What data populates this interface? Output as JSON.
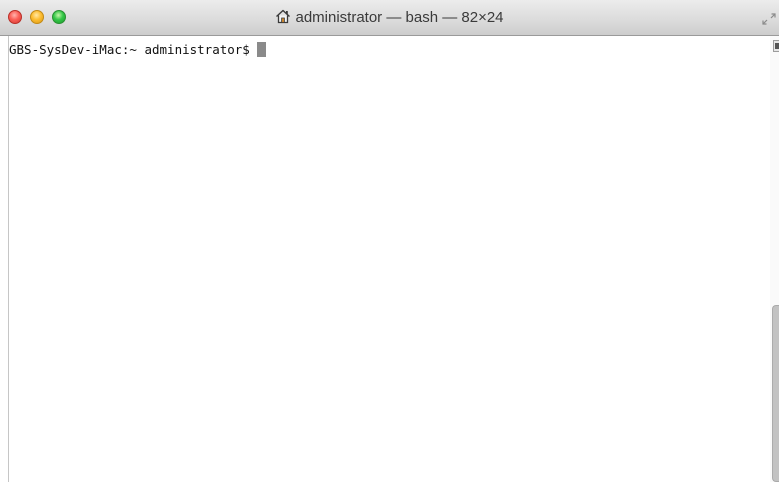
{
  "window": {
    "title": "administrator — bash — 82×24"
  },
  "icons": {
    "title_icon": "home-icon",
    "fullscreen_icon": "fullscreen-arrows-icon",
    "close": "close-icon",
    "minimize": "minimize-icon",
    "zoom": "zoom-icon"
  },
  "colors": {
    "close": "#fb5f57",
    "minimize": "#fdbd31",
    "zoom": "#34c748",
    "terminal_background": "#ffffff",
    "terminal_text": "#111111",
    "cursor": "#8a8a8a"
  },
  "terminal": {
    "prompt": "GBS-SysDev-iMac:~ administrator$"
  }
}
